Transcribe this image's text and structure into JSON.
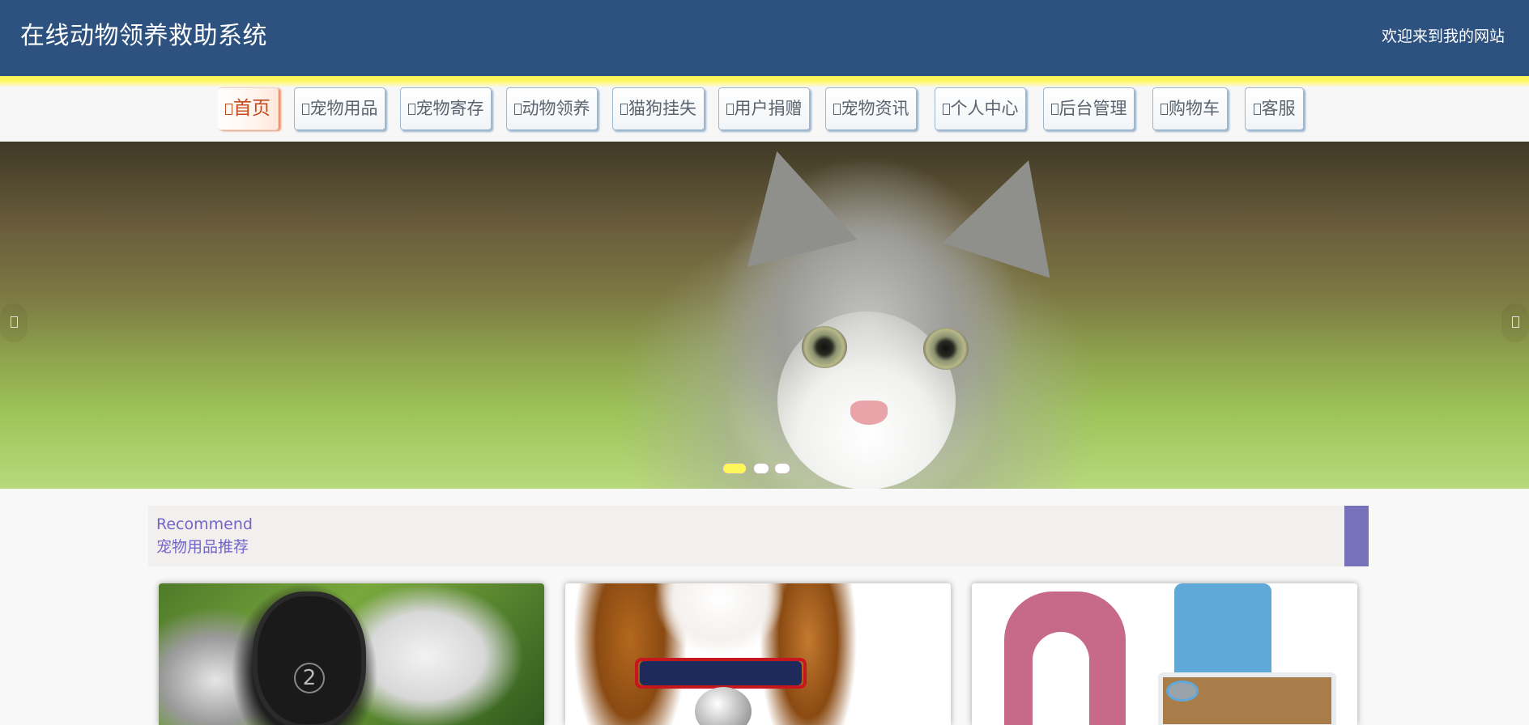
{
  "header": {
    "title": "在线动物领养救助系统",
    "welcome": "欢迎来到我的网站"
  },
  "nav": {
    "items": [
      {
        "label": "首页",
        "active": true
      },
      {
        "label": "宠物用品"
      },
      {
        "label": "宠物寄存"
      },
      {
        "label": "动物领养"
      },
      {
        "label": "猫狗挂失"
      },
      {
        "label": "用户捐赠"
      },
      {
        "label": "宠物资讯"
      },
      {
        "label": "个人中心"
      },
      {
        "label": "后台管理"
      },
      {
        "label": "购物车"
      },
      {
        "label": "客服"
      }
    ]
  },
  "banner": {
    "image": "kitten-in-grass",
    "slides": 3,
    "active_slide": 1,
    "accent": "#fff65a"
  },
  "recommend": {
    "title_en": "Recommend",
    "title_cn": "宠物用品推荐",
    "accent": "#7671b9"
  },
  "products": [
    {
      "image": "dog-shoes"
    },
    {
      "image": "dog-with-bow-tie"
    },
    {
      "image": "pet-furniture-set"
    }
  ],
  "colors": {
    "header_bg": "#2e527f",
    "nav_active": "#c64a1c",
    "recommend_text": "#7464c7"
  }
}
